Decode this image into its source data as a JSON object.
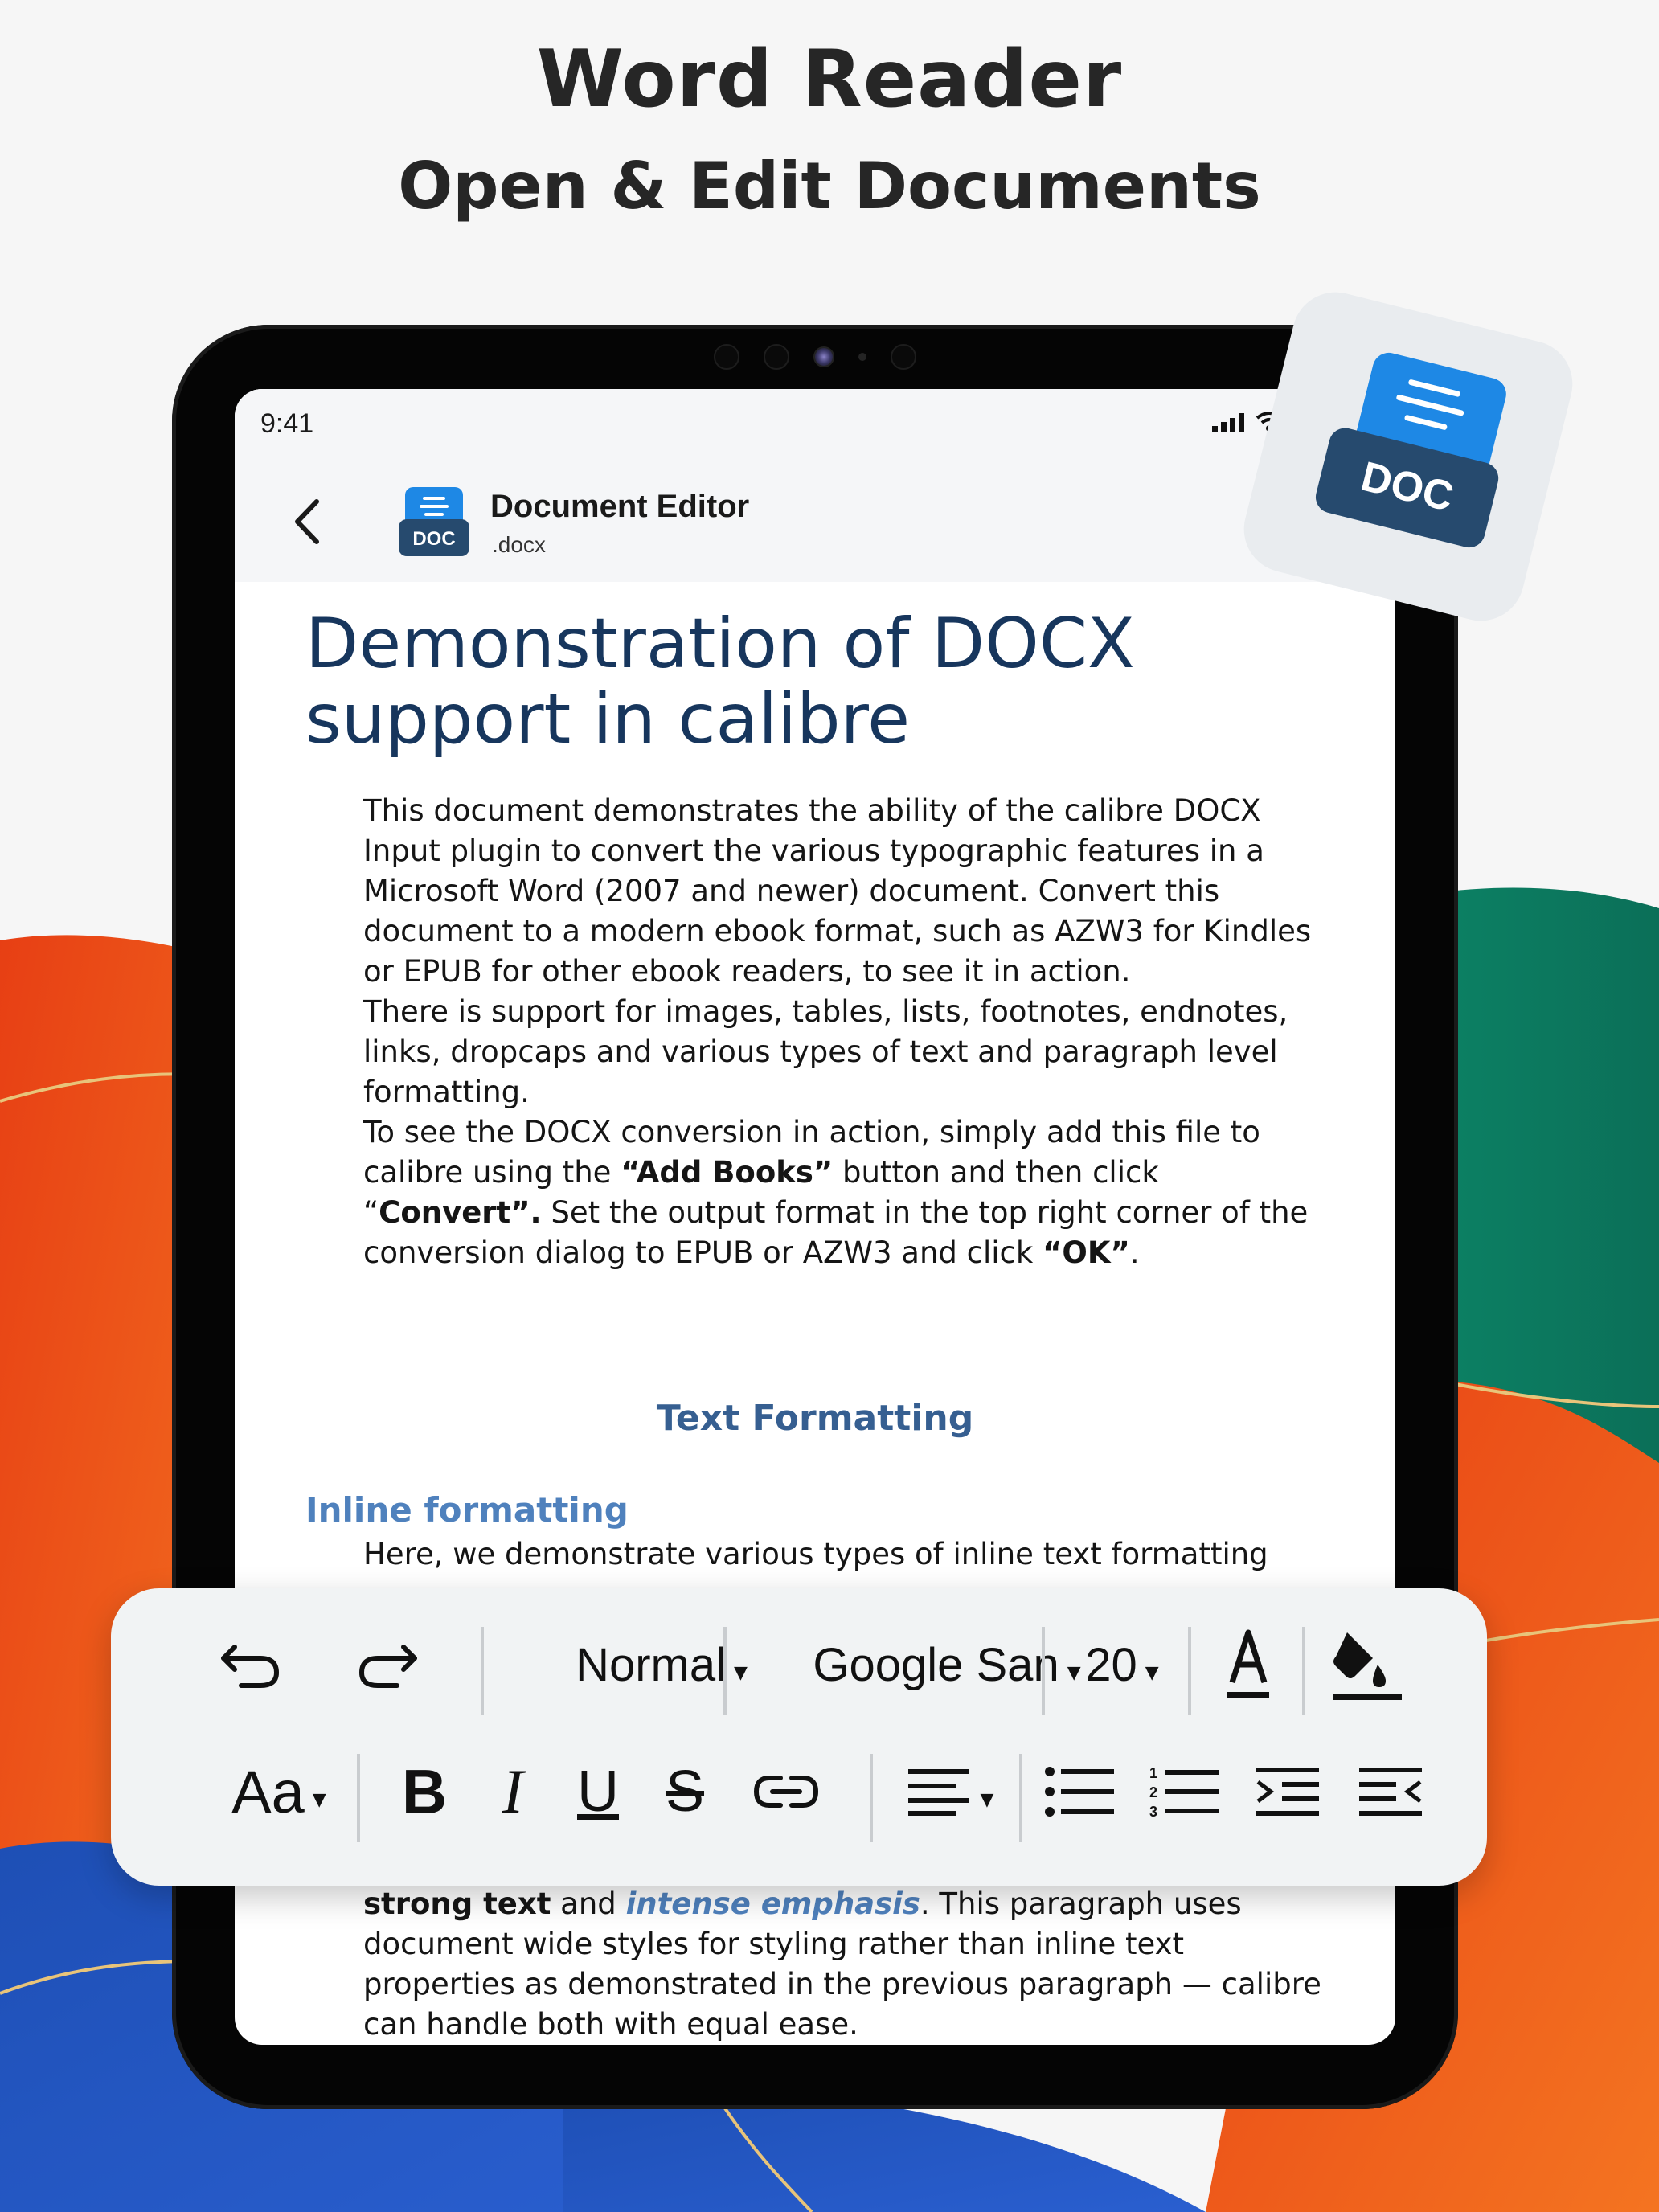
{
  "header": {
    "title": "Word Reader",
    "subtitle": "Open & Edit Documents"
  },
  "status_bar": {
    "time": "9:41"
  },
  "app_bar": {
    "title": "Document Editor",
    "subtitle": ".docx",
    "icon_label": "DOC"
  },
  "floating_badge": {
    "label": "DOC"
  },
  "document": {
    "title": "Demonstration of DOCX support in calibre",
    "paragraphs": [
      "This document demonstrates the ability of the calibre DOCX Input plugin to convert the various typographic features in a Microsoft Word (2007 and newer) document. Convert this document to a modern ebook format, such as AZW3 for Kindles or EPUB for other ebook readers, to see it in action.",
      "There is support for images, tables, lists, footnotes, endnotes, links, dropcaps and various types of text and paragraph level formatting."
    ],
    "p3": {
      "a": "To see the DOCX conversion in action, simply add this file to calibre using the ",
      "b": "“Add Books”",
      "c": " button and then click “",
      "d": "Convert”.",
      "e": " Set the output format in the top right corner of the conversion dialog to EPUB or AZW3 and click ",
      "f": "“OK”",
      "g": "."
    },
    "section_heading": "Text Formatting",
    "subheading": "Inline formatting",
    "p4": "Here, we demonstrate various types of inline text formatting",
    "p5": {
      "a": "strong text",
      "b": " and ",
      "c": "intense emphasis",
      "d": ". This paragraph uses document wide styles for styling rather than inline text properties as demonstrated in the previous paragraph — calibre can handle both with equal ease."
    }
  },
  "toolbar": {
    "row1": {
      "undo_icon": "undo-icon",
      "redo_icon": "redo-icon",
      "style_value": "Normal",
      "font_value": "Google San",
      "size_value": "20",
      "text_color_icon": "text-color-icon",
      "fill_icon": "paint-bucket-icon"
    },
    "row2": {
      "text_size_label": "Aa",
      "bold": "B",
      "italic": "I",
      "underline": "U",
      "strike": "S"
    }
  },
  "colors": {
    "doc_title": "#17365d",
    "heading": "#365f91",
    "subheading": "#4f81bd",
    "accent_blue": "#1e88e5"
  }
}
